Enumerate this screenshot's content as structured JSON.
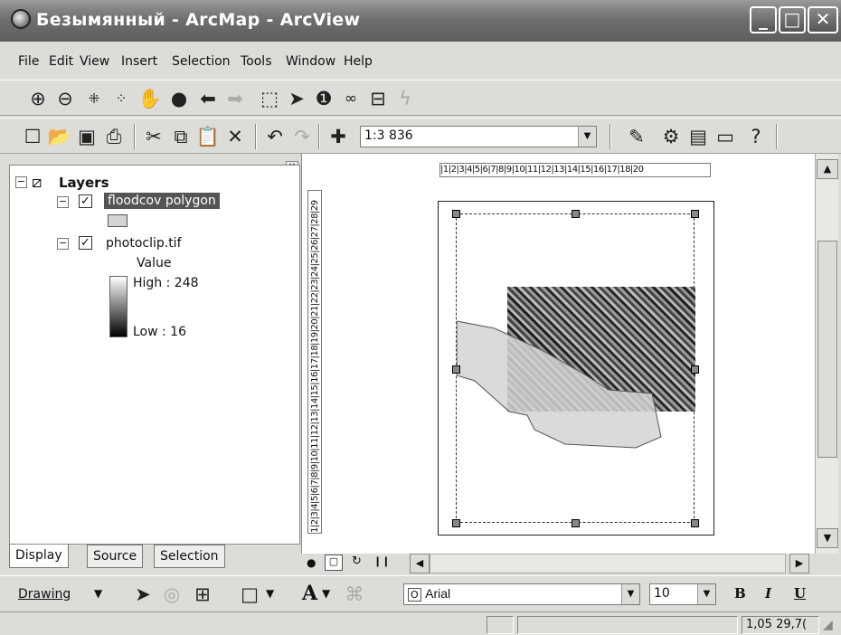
{
  "window": {
    "title": "Безымянный - ArcMap - ArcView",
    "min": "_",
    "max": "□",
    "close": "✕"
  },
  "menu": [
    "File",
    "Edit",
    "View",
    "Insert",
    "Selection",
    "Tools",
    "Window",
    "Help"
  ],
  "tools_toolbar": [
    "zoom-in-icon",
    "zoom-out-icon",
    "fixed-zoom-in-icon",
    "fixed-zoom-out-icon",
    "pan-hand-icon",
    "full-extent-globe-icon",
    "back-arrow-icon",
    "forward-arrow-icon",
    "select-features-icon",
    "select-elements-icon",
    "identify-icon",
    "find-binoculars-icon",
    "measure-icon",
    "hyperlink-icon"
  ],
  "standard_toolbar": [
    "new-icon",
    "open-icon",
    "save-icon",
    "print-icon",
    "cut-icon",
    "copy-icon",
    "paste-icon",
    "delete-icon",
    "undo-icon",
    "redo-icon",
    "add-data-icon"
  ],
  "scale": {
    "value": "1:3 836"
  },
  "toc": {
    "root": "Layers",
    "layers": [
      {
        "name": "floodcov polygon",
        "checked": true,
        "selected": true
      },
      {
        "name": "photoclip.tif",
        "checked": true,
        "legend": {
          "title": "Value",
          "high": "High : 248",
          "low": "Low : 16"
        }
      }
    ],
    "tabs": [
      "Display",
      "Source",
      "Selection"
    ]
  },
  "ruler": {
    "top": "|1|2|3|4|5|6|7|8|9|10|11|12|13|14|15|16|17|18|20",
    "left": "1|2|3|4|5|6|7|8|9|10|11|12|13|14|15|16|17|18|19|20|21|22|23|24|25|26|27|28|29"
  },
  "drawing": {
    "menu": "Drawing",
    "font": "Arial",
    "size": "10",
    "bold": "B",
    "italic": "I",
    "underline": "U",
    "text_tool": "A"
  },
  "status": {
    "coords": "1,05 29,7("
  },
  "colors": {
    "titlebar": "#6f6f6f",
    "selection": "#555555",
    "polygon": "#d4d4d4"
  }
}
